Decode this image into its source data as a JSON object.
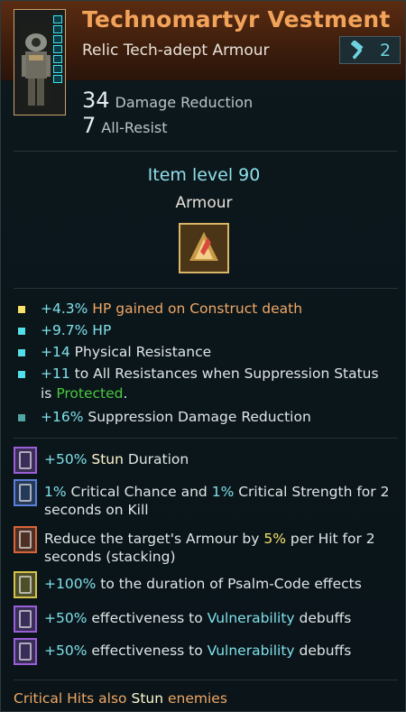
{
  "item": {
    "name": "Technomartyr Vestment",
    "rarity_type": "Relic Tech-adept Armour",
    "tier_badge": "2",
    "tier_icon": "hammer-icon",
    "stats": [
      {
        "value": "34",
        "label": "Damage Reduction"
      },
      {
        "value": "7",
        "label": "All-Resist"
      }
    ],
    "item_level": "Item level 90",
    "category": "Armour"
  },
  "mods": [
    {
      "color": "#f6e16a",
      "parts": [
        [
          "+4.3%",
          "cy"
        ],
        [
          " HP gained on Construct death",
          "or"
        ]
      ]
    },
    {
      "color": "#4fe0ea",
      "parts": [
        [
          "+9.7%",
          "cy"
        ],
        [
          " HP",
          "cy"
        ]
      ]
    },
    {
      "color": "#4fe0ea",
      "parts": [
        [
          "+14",
          "cy"
        ],
        [
          " Physical Resistance",
          "wt"
        ]
      ]
    },
    {
      "color": "#4fe0ea",
      "parts": [
        [
          "+11",
          "cy"
        ],
        [
          " to All Resistances when Suppression Status is ",
          "wt"
        ],
        [
          "Protected",
          "gr"
        ],
        [
          ".",
          "wt"
        ]
      ]
    },
    {
      "color": "#4fa5a5",
      "parts": [
        [
          "+16%",
          "cy"
        ],
        [
          " Suppression Damage Reduction",
          "wt"
        ]
      ]
    }
  ],
  "perks": [
    {
      "glyph": "#9a5fd6",
      "parts": [
        [
          "+50%",
          "cy"
        ],
        [
          " Stun",
          "wh"
        ],
        [
          " Duration",
          "wt"
        ]
      ]
    },
    {
      "glyph": "#5a7fd6",
      "parts": [
        [
          "1%",
          "cy"
        ],
        [
          " Critical Chance and ",
          "wt"
        ],
        [
          "1%",
          "cy"
        ],
        [
          " Critical Strength for 2 seconds on Kill",
          "wt"
        ]
      ]
    },
    {
      "glyph": "#d8643a",
      "parts": [
        [
          "Reduce the target's Armour by ",
          "wt"
        ],
        [
          "5%",
          "yl"
        ],
        [
          " per Hit for 2 seconds (stacking)",
          "wt"
        ]
      ]
    },
    {
      "glyph": "#d6c24a",
      "parts": [
        [
          "+100%",
          "cy"
        ],
        [
          " to the duration of Psalm-Code effects",
          "wt"
        ]
      ]
    },
    {
      "glyph": "#9a5fd6",
      "parts": [
        [
          "+50%",
          "cy"
        ],
        [
          " effectiveness to ",
          "wt"
        ],
        [
          "Vulnerability",
          "cy"
        ],
        [
          " debuffs",
          "wt"
        ]
      ]
    },
    {
      "glyph": "#9a5fd6",
      "parts": [
        [
          "+50%",
          "cy"
        ],
        [
          " effectiveness to ",
          "wt"
        ],
        [
          "Vulnerability",
          "cy"
        ],
        [
          " debuffs",
          "wt"
        ]
      ]
    }
  ],
  "footer": [
    [
      "Critical Hits also ",
      "or"
    ],
    [
      "Stun",
      "wh"
    ],
    [
      " enemies",
      "or"
    ]
  ],
  "colors": {
    "title": "#f2a35a",
    "accent": "#7fe0ea",
    "header_bg": "#4a2410"
  }
}
